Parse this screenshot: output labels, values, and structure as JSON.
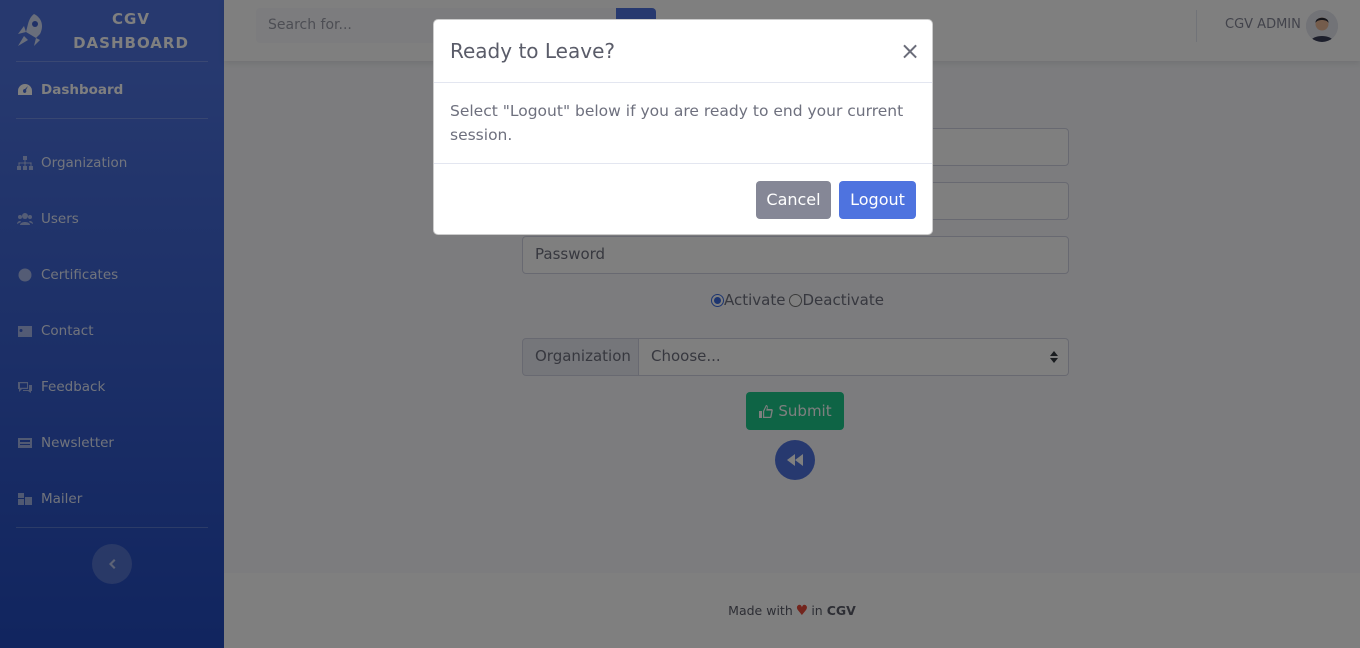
{
  "sidebar": {
    "brand_line1": "CGV",
    "brand_line2": "DASHBOARD",
    "items": [
      {
        "label": "Dashboard",
        "icon": "tachometer-icon"
      },
      {
        "label": "Organization",
        "icon": "sitemap-icon"
      },
      {
        "label": "Users",
        "icon": "users-icon"
      },
      {
        "label": "Certificates",
        "icon": "certificate-icon"
      },
      {
        "label": "Contact",
        "icon": "address-card-icon"
      },
      {
        "label": "Feedback",
        "icon": "comments-icon"
      },
      {
        "label": "Newsletter",
        "icon": "newspaper-icon"
      },
      {
        "label": "Mailer",
        "icon": "mail-bulk-icon"
      }
    ]
  },
  "topbar": {
    "search_placeholder": "Search for...",
    "user_name": "CGV ADMIN"
  },
  "form": {
    "password_placeholder": "Password",
    "radio_activate": "Activate",
    "radio_deactivate": "Deactivate",
    "org_label": "Organization",
    "org_selected": "Choose...",
    "submit_label": "Submit"
  },
  "footer": {
    "made_with": "Made with",
    "in": "in",
    "brand": "CGV"
  },
  "modal": {
    "title": "Ready to Leave?",
    "close_glyph": "×",
    "body": "Select \"Logout\" below if you are ready to end your current session.",
    "cancel_label": "Cancel",
    "logout_label": "Logout"
  },
  "colors": {
    "primary": "#4e73df",
    "success": "#1cc88a",
    "secondary": "#858796",
    "danger": "#e74a3b"
  }
}
